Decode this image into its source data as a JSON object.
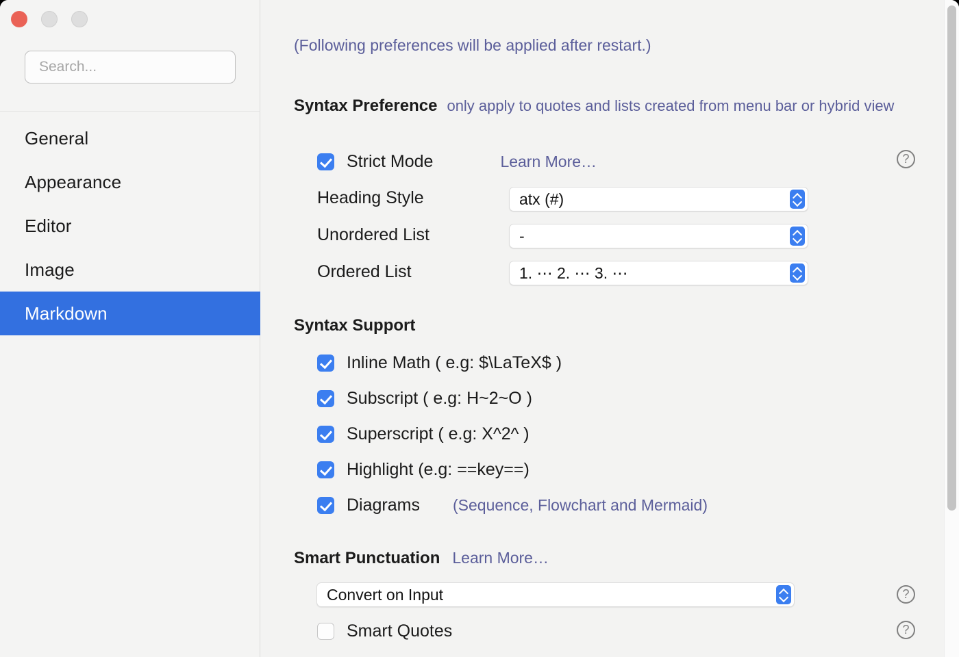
{
  "window": {
    "traffic_lights": [
      "close",
      "minimize",
      "zoom"
    ]
  },
  "sidebar": {
    "search": {
      "placeholder": "Search...",
      "value": ""
    },
    "items": [
      {
        "label": "General",
        "selected": false
      },
      {
        "label": "Appearance",
        "selected": false
      },
      {
        "label": "Editor",
        "selected": false
      },
      {
        "label": "Image",
        "selected": false
      },
      {
        "label": "Markdown",
        "selected": true
      }
    ]
  },
  "content": {
    "notice": "(Following preferences will be applied after restart.)",
    "syntax_preference": {
      "title": "Syntax Preference",
      "note": "only apply to quotes and lists created from menu bar or hybrid view",
      "strict_mode": {
        "label": "Strict Mode",
        "checked": true,
        "learn_more": "Learn More…",
        "help": "?"
      },
      "fields": [
        {
          "label": "Heading Style",
          "value": "atx (#)"
        },
        {
          "label": "Unordered List",
          "value": "-"
        },
        {
          "label": "Ordered List",
          "value": "1. ⋯ 2. ⋯ 3. ⋯"
        }
      ]
    },
    "syntax_support": {
      "title": "Syntax Support",
      "items": [
        {
          "label": "Inline Math ( e.g: $\\LaTeX$ )",
          "checked": true,
          "note": ""
        },
        {
          "label": "Subscript ( e.g: H~2~O )",
          "checked": true,
          "note": ""
        },
        {
          "label": "Superscript ( e.g: X^2^ )",
          "checked": true,
          "note": ""
        },
        {
          "label": "Highlight (e.g: ==key==)",
          "checked": true,
          "note": ""
        },
        {
          "label": "Diagrams",
          "checked": true,
          "note": "(Sequence, Flowchart and Mermaid)"
        }
      ]
    },
    "smart_punctuation": {
      "title": "Smart Punctuation",
      "learn_more": "Learn More…",
      "select_value": "Convert on Input",
      "select_help": "?",
      "smart_quotes": {
        "label": "Smart Quotes",
        "checked": false,
        "help": "?"
      }
    }
  },
  "colors": {
    "accent": "#3370e0",
    "checkbox": "#3b7ef0",
    "link": "#5b5e9a",
    "close": "#ea6256",
    "inactive_light": "#dedede"
  }
}
